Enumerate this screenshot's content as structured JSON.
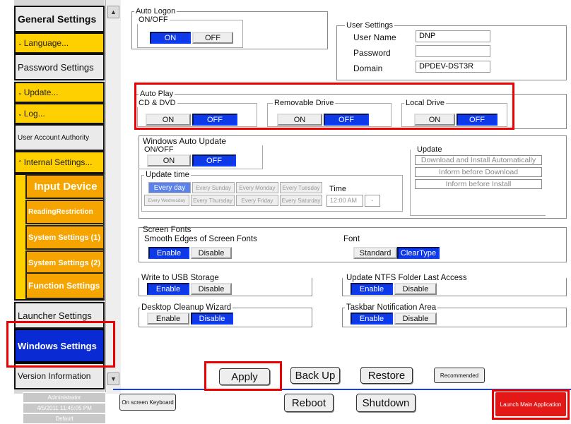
{
  "sidebar": {
    "general_settings": "General Settings",
    "language": "Language...",
    "password_settings": "Password Settings",
    "update": "Update...",
    "log": "Log...",
    "user_account_authority": "User Account Authority",
    "internal_settings": "Internal Settings...",
    "input_device": "Input Device",
    "reading_restriction": "ReadingRestriction",
    "system_settings_1": "System Settings (1)",
    "system_settings_2": "System Settings (2)",
    "function_settings": "Function Settings",
    "launcher_settings": "Launcher Settings",
    "windows_settings": "Windows Settings",
    "version_information": "Version Information"
  },
  "status": {
    "user": "Administrator",
    "datetime": "4/5/2011 11:45:05 PM",
    "profile": "Default"
  },
  "auto_logon": {
    "title": "Auto Logon",
    "onoff": "ON/OFF",
    "on": "ON",
    "off": "OFF",
    "selected": "ON"
  },
  "user_settings": {
    "title": "User Settings",
    "user_name_label": "User Name",
    "user_name": "DNP",
    "password_label": "Password",
    "password": "",
    "domain_label": "Domain",
    "domain": "DPDEV-DST3R"
  },
  "auto_play": {
    "title": "Auto Play",
    "cd_dvd": "CD & DVD",
    "removable": "Removable Drive",
    "local": "Local Drive",
    "on": "ON",
    "off": "OFF"
  },
  "windows_update": {
    "title": "Windows Auto Update",
    "onoff": "ON/OFF",
    "on": "ON",
    "off": "OFF",
    "update_time": "Update time",
    "days": [
      "Every day",
      "Every Sunday",
      "Every Monday",
      "Every Tuesday",
      "Every Wednesday",
      "Every Thursday",
      "Every Friday",
      "Every Saturday"
    ],
    "time_label": "Time",
    "time_value": "12:00 AM",
    "update_title": "Update",
    "options": [
      "Download and Install Automatically",
      "Inform before Download",
      "Inform before Install"
    ]
  },
  "screen_fonts": {
    "title": "Screen Fonts",
    "smooth": "Smooth Edges of Screen Fonts",
    "enable": "Enable",
    "disable": "Disable",
    "font_label": "Font",
    "standard": "Standard",
    "cleartype": "ClearType"
  },
  "usb": {
    "title": "Write to USB Storage",
    "enable": "Enable",
    "disable": "Disable"
  },
  "ntfs": {
    "title": "Update NTFS Folder Last Access",
    "enable": "Enable",
    "disable": "Disable"
  },
  "cleanup": {
    "title": "Desktop Cleanup Wizard",
    "enable": "Enable",
    "disable": "Disable"
  },
  "taskbar": {
    "title": "Taskbar Notification Area",
    "enable": "Enable",
    "disable": "Disable"
  },
  "actions": {
    "apply": "Apply",
    "backup": "Back Up",
    "restore": "Restore",
    "recommended": "Recommended",
    "keyboard": "On screen Keyboard",
    "reboot": "Reboot",
    "shutdown": "Shutdown",
    "launch": "Launch Main Application"
  },
  "colors": {
    "accent_blue": "#0d39e8",
    "sidebar_yellow": "#ffd000",
    "sub_orange": "#f5a400",
    "highlight_red": "#e00000"
  }
}
